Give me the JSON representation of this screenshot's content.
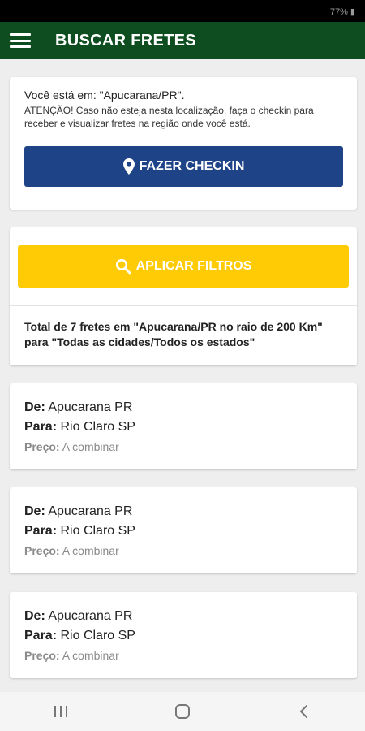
{
  "status_bar": {
    "right": "77% ▮"
  },
  "app_bar": {
    "title": "BUSCAR FRETES",
    "menu_icon": "hamburger-menu-icon"
  },
  "location_card": {
    "label": "Você está em: ",
    "city": "\"Apucarana/PR\".",
    "warning": "ATENÇÃO! Caso não esteja nesta localização, faça o checkin para receber e visualizar fretes na região onde você está.",
    "checkin_label": "FAZER CHECKIN",
    "checkin_icon": "map-pin-icon",
    "checkin_color": "#1e4386"
  },
  "filter_card": {
    "filter_label": "APLICAR FILTROS",
    "filter_icon": "search-icon",
    "filter_color": "#ffcb05",
    "total_text": "Total de 7 fretes em \"Apucarana/PR no raio de 200 Km\" para \"Todas as cidades/Todos os estados\""
  },
  "labels": {
    "from": "De:",
    "to": "Para:",
    "price": "Preço:"
  },
  "freights": [
    {
      "from": "Apucarana PR",
      "to": "Rio Claro SP",
      "price": "A combinar"
    },
    {
      "from": "Apucarana PR",
      "to": "Rio Claro SP",
      "price": "A combinar"
    },
    {
      "from": "Apucarana PR",
      "to": "Rio Claro SP",
      "price": "A combinar"
    }
  ],
  "nav": {
    "recents": "recents-icon",
    "home": "home-icon",
    "back": "back-icon"
  },
  "colors": {
    "app_bar": "#0e4d1f"
  }
}
